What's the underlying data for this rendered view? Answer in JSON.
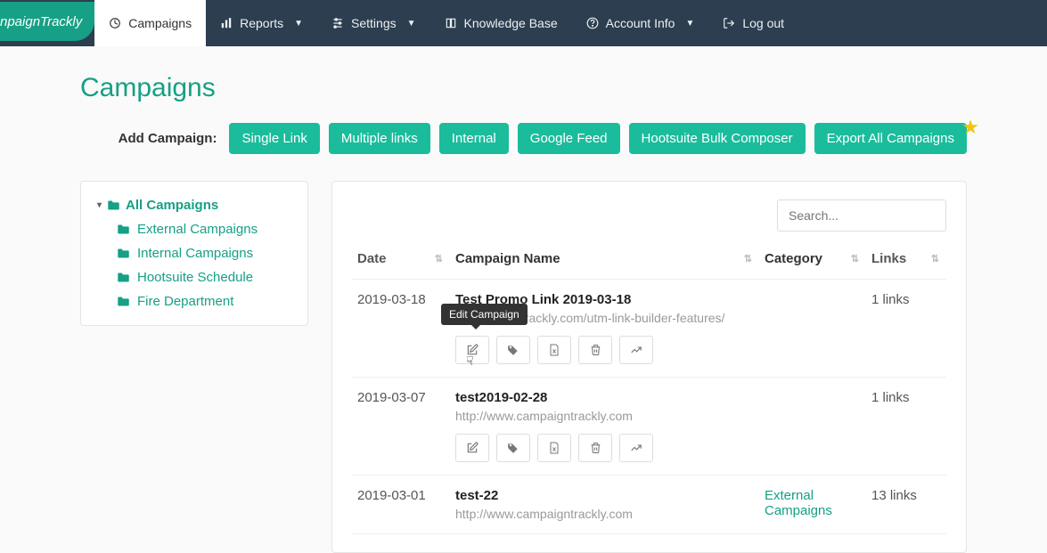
{
  "brand": "npaignTrackly",
  "nav": {
    "campaigns": "Campaigns",
    "reports": "Reports",
    "settings": "Settings",
    "kb": "Knowledge Base",
    "account": "Account Info",
    "logout": "Log out"
  },
  "page_title": "Campaigns",
  "toolbar": {
    "label": "Add Campaign:",
    "single": "Single Link",
    "multiple": "Multiple links",
    "internal": "Internal",
    "google": "Google Feed",
    "hootsuite": "Hootsuite Bulk Composer",
    "export": "Export All Campaigns"
  },
  "sidebar": {
    "root": "All Campaigns",
    "items": [
      {
        "label": "External Campaigns"
      },
      {
        "label": "Internal Campaigns"
      },
      {
        "label": "Hootsuite Schedule"
      },
      {
        "label": "Fire Department"
      }
    ]
  },
  "search": {
    "placeholder": "Search..."
  },
  "columns": {
    "date": "Date",
    "name": "Campaign Name",
    "category": "Category",
    "links": "Links"
  },
  "tooltip": {
    "edit": "Edit Campaign"
  },
  "rows": [
    {
      "date": "2019-03-18",
      "name": "Test Promo Link 2019-03-18",
      "url_visible": "w.campaigntrackly.com/utm-link-builder-features/",
      "category": "",
      "links": "1 links"
    },
    {
      "date": "2019-03-07",
      "name": "test2019-02-28",
      "url_visible": "http://www.campaigntrackly.com",
      "category": "",
      "links": "1 links"
    },
    {
      "date": "2019-03-01",
      "name": "test-22",
      "url_visible": "http://www.campaigntrackly.com",
      "category": "External Campaigns",
      "links": "13 links"
    }
  ]
}
